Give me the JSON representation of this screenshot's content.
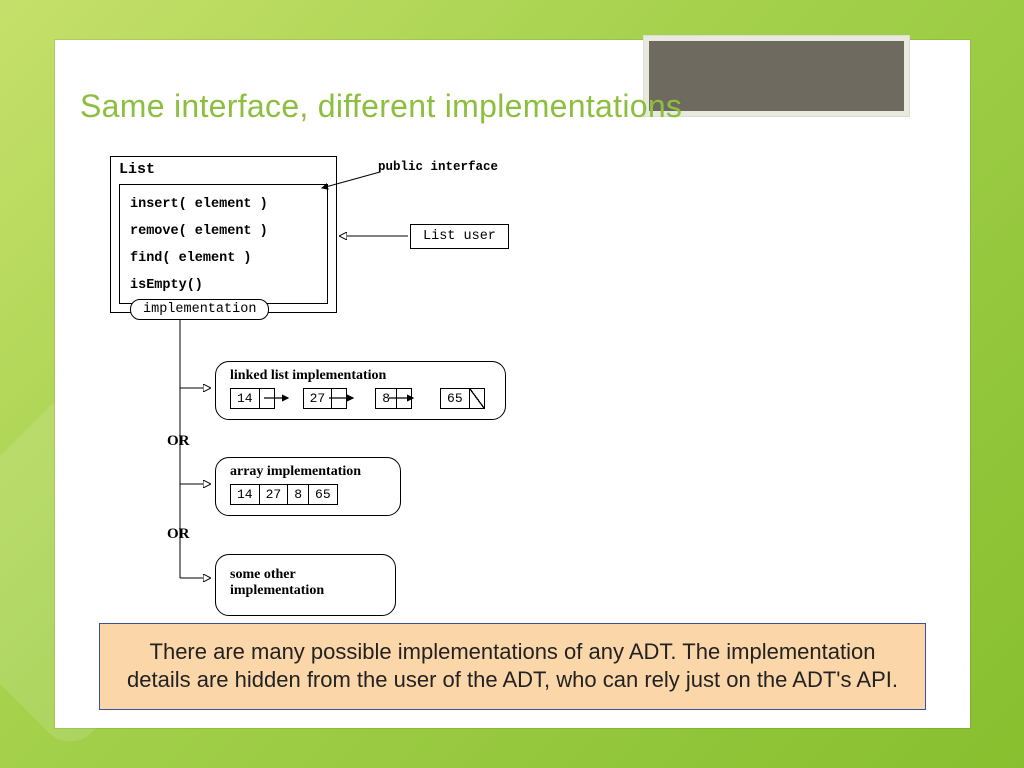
{
  "title": "Same interface, different implementations",
  "list": {
    "name": "List",
    "methods": [
      "insert( element )",
      "remove( element )",
      "find( element )",
      "isEmpty()"
    ]
  },
  "labels": {
    "public_interface": "public interface",
    "list_user": "List user",
    "implementation": "implementation",
    "or": "OR"
  },
  "linked_list": {
    "title": "linked list implementation",
    "values": [
      "14",
      "27",
      "8",
      "65"
    ]
  },
  "array_impl": {
    "title": "array implementation",
    "values": [
      "14",
      "27",
      "8",
      "65"
    ]
  },
  "other_impl": {
    "title": "some other implementation"
  },
  "callout": "There are many possible implementations of any ADT. The implementation details are hidden from the user of the ADT, who can rely just on the ADT's API."
}
